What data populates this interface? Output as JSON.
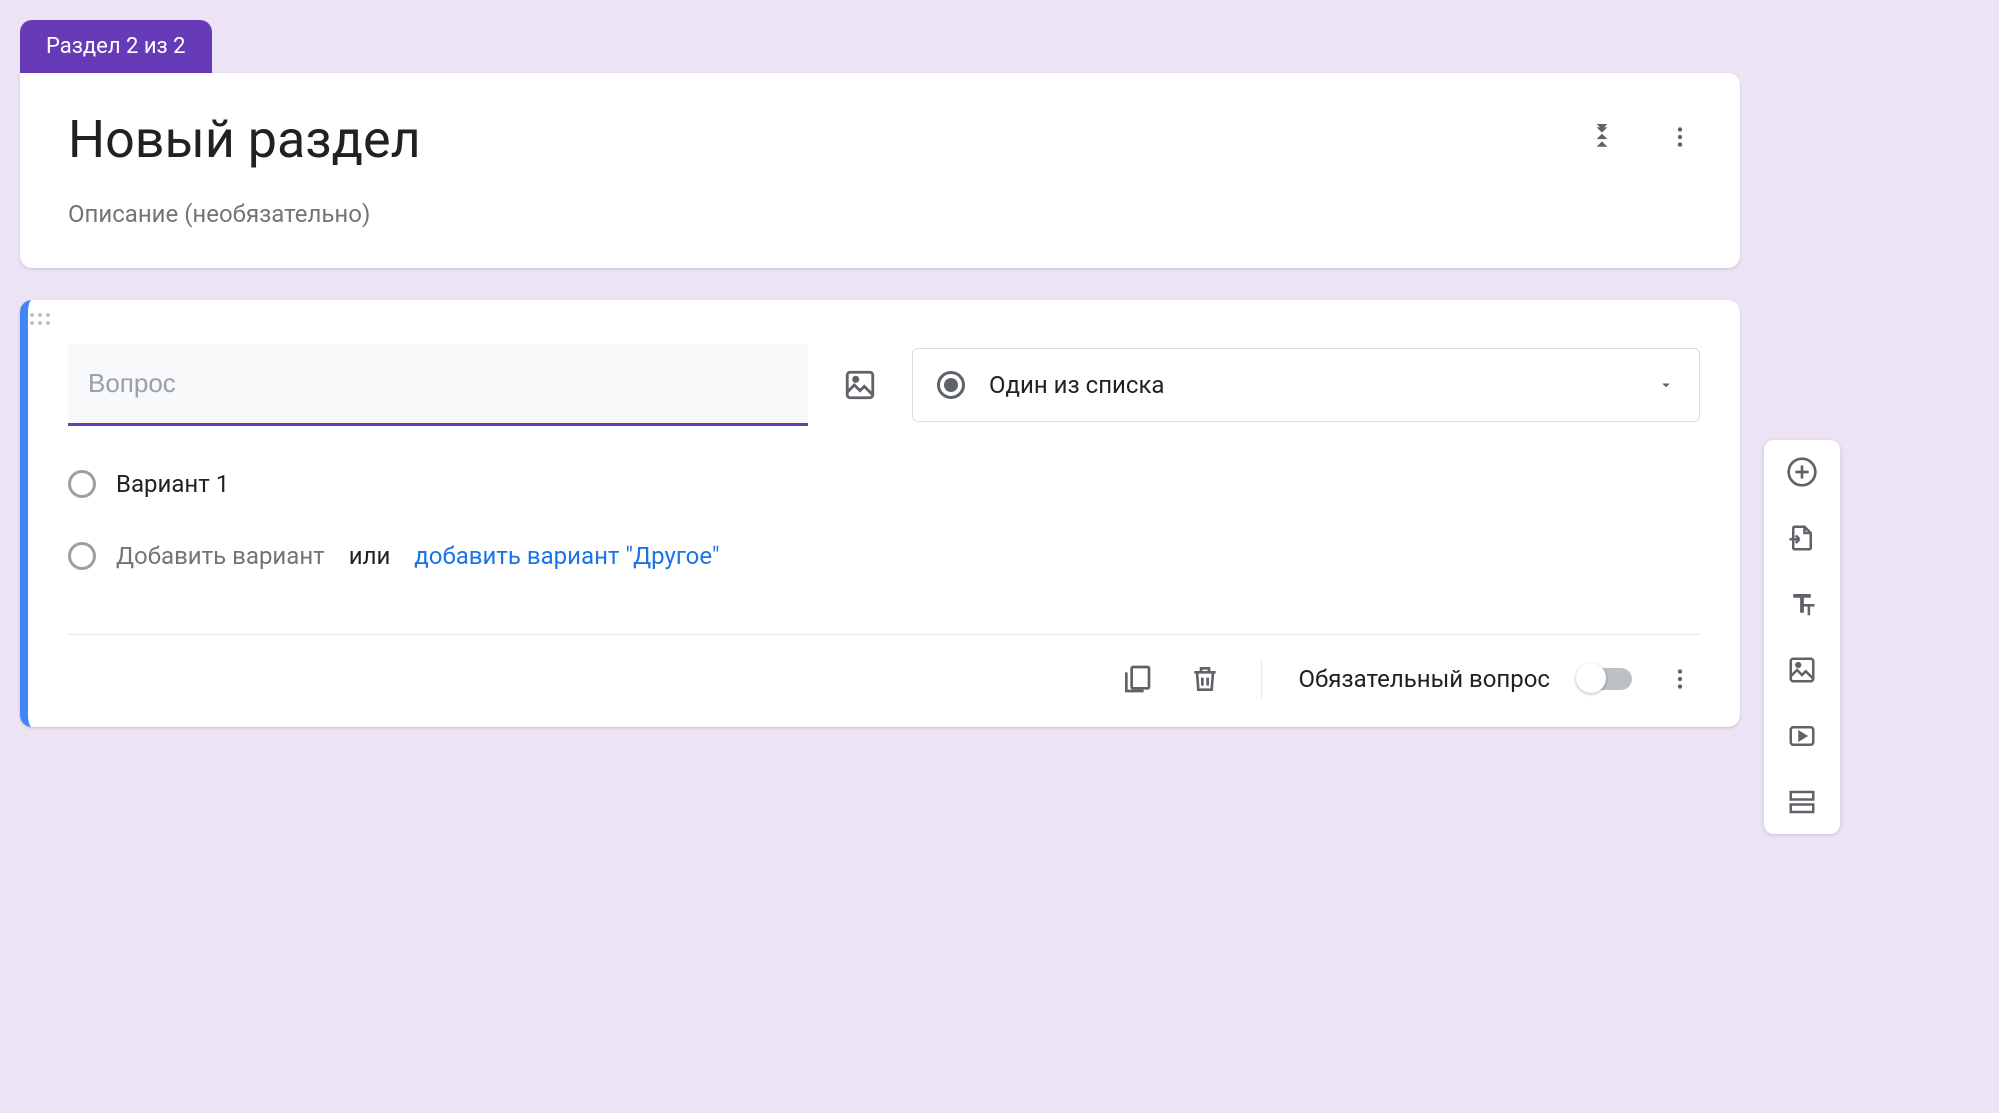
{
  "section": {
    "tab_label": "Раздел 2 из 2",
    "title": "Новый раздел",
    "description_placeholder": "Описание (необязательно)"
  },
  "question": {
    "placeholder": "Вопрос",
    "type_label": "Один из списка",
    "option1": "Вариант 1",
    "add_option": "Добавить вариант",
    "or": "или",
    "add_other": "добавить вариант \"Другое\""
  },
  "footer": {
    "required_label": "Обязательный вопрос"
  }
}
